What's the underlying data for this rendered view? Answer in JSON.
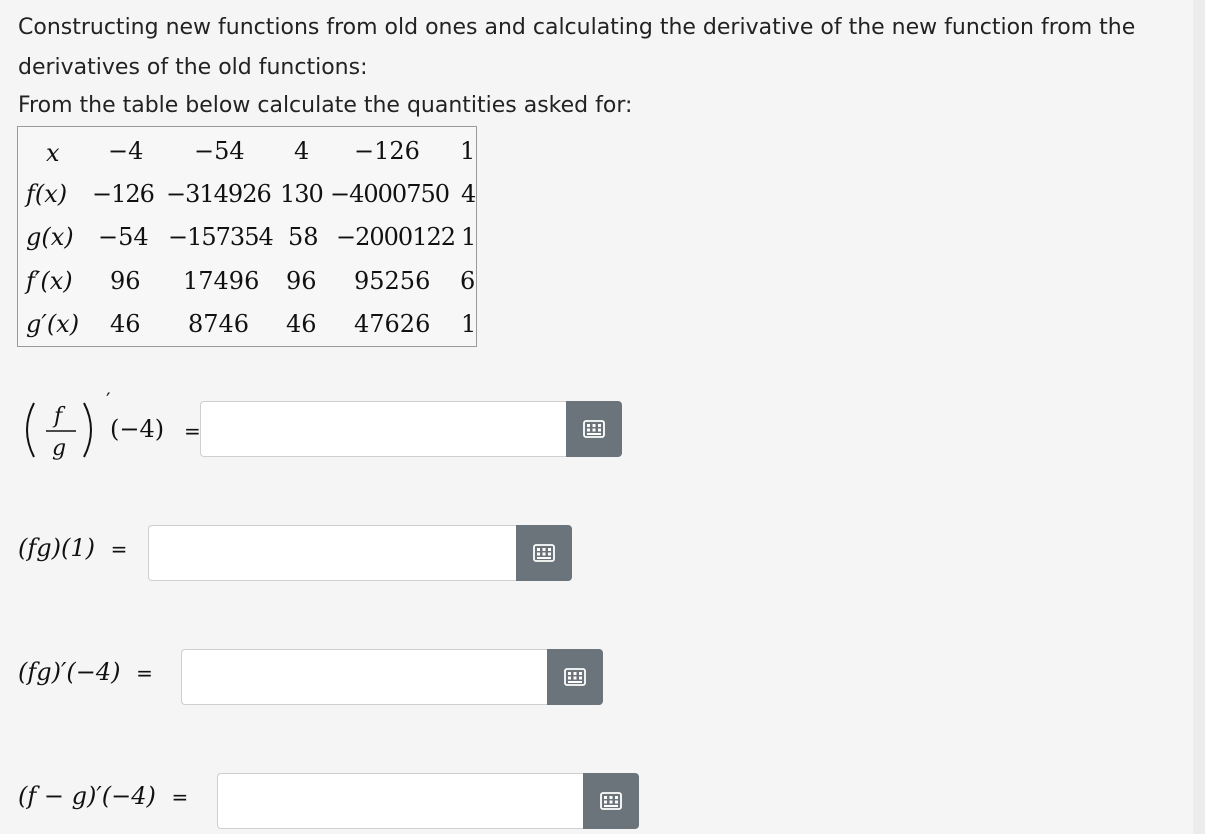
{
  "intro": {
    "line1": "Constructing new functions from old ones and calculating the derivative of the new function from the",
    "line2": "derivatives of the old functions:",
    "line3": "From the table below calculate the quantities asked for:"
  },
  "table": {
    "header": [
      "x",
      "−4",
      "−54",
      "4",
      "−126",
      "1"
    ],
    "rows": [
      {
        "label": "f(x)",
        "values": [
          "−126",
          "−314926",
          "130",
          "−4000750",
          "4"
        ]
      },
      {
        "label": "g(x)",
        "values": [
          "−54",
          "−157354",
          "58",
          "−2000122",
          "1"
        ]
      },
      {
        "label": "f′(x)",
        "values": [
          "96",
          "17496",
          "96",
          "95256",
          "6"
        ]
      },
      {
        "label": "g′(x)",
        "values": [
          "46",
          "8746",
          "46",
          "47626",
          "1"
        ]
      }
    ]
  },
  "questions": [
    {
      "id": "q1",
      "point": "(−4)",
      "equals": "=",
      "value": ""
    },
    {
      "id": "q2",
      "expr": "(fg)(1)",
      "equals": "=",
      "value": ""
    },
    {
      "id": "q3",
      "expr": "(fg)′(−4)",
      "equals": "=",
      "value": ""
    },
    {
      "id": "q4",
      "expr": "(f − g)′(−4)",
      "equals": "=",
      "value": ""
    }
  ],
  "icons": {
    "keyboard_button": "keyboard-icon"
  },
  "colors": {
    "button_bg": "#6b737b",
    "input_bg": "#ffffff",
    "page_bg": "#f5f5f5"
  }
}
